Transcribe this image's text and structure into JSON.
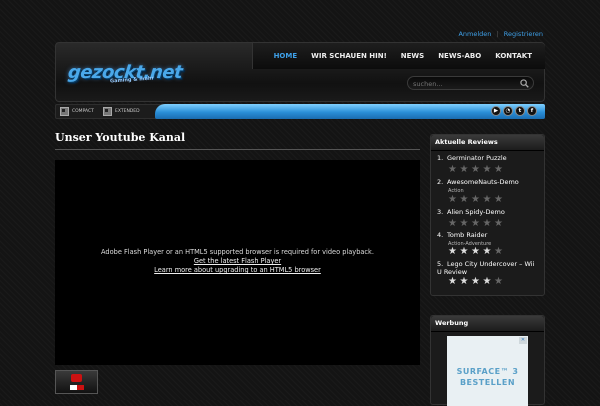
{
  "top_links": {
    "login": "Anmelden",
    "separator": "|",
    "register": "Registrieren"
  },
  "logo": {
    "text": "gezockt.net",
    "tagline": "Gaming & mehr"
  },
  "nav": [
    "HOME",
    "WIR SCHAUEN HIN!",
    "NEWS",
    "NEWS-ABO",
    "KONTAKT"
  ],
  "nav_active_index": 0,
  "search": {
    "placeholder": "suchen..."
  },
  "view_modes": {
    "compact": "COMPACT",
    "extended": "EXTENDED"
  },
  "social_icons": [
    "youtube-icon",
    "rss-icon",
    "twitter-icon",
    "facebook-icon"
  ],
  "main": {
    "title": "Unser Youtube Kanal",
    "player_message": "Adobe Flash Player or an HTML5 supported browser is required for video playback.",
    "player_link_1": "Get the latest Flash Player",
    "player_link_2": "Learn more about upgrading to an HTML5 browser"
  },
  "reviews": {
    "title": "Aktuelle Reviews",
    "items": [
      {
        "num": "1.",
        "name": "Germinator Puzzle",
        "genre": "",
        "rating": 0
      },
      {
        "num": "2.",
        "name": "AwesomeNauts-Demo",
        "genre": "Action",
        "rating": 0
      },
      {
        "num": "3.",
        "name": "Alien Spidy-Demo",
        "genre": "",
        "rating": 0
      },
      {
        "num": "4.",
        "name": "Tomb Raider",
        "genre": "Action-Adventure",
        "rating": 4
      },
      {
        "num": "5.",
        "name": "Lego City Undercover – Wii U Review",
        "genre": "",
        "rating": 4
      }
    ]
  },
  "ad": {
    "title": "Werbung",
    "line1": "SURFACE™ 3",
    "line2": "BESTELLEN",
    "close": "✕"
  },
  "colors": {
    "accent": "#3ea0e8",
    "bar_blue": "#2a8fd8"
  }
}
